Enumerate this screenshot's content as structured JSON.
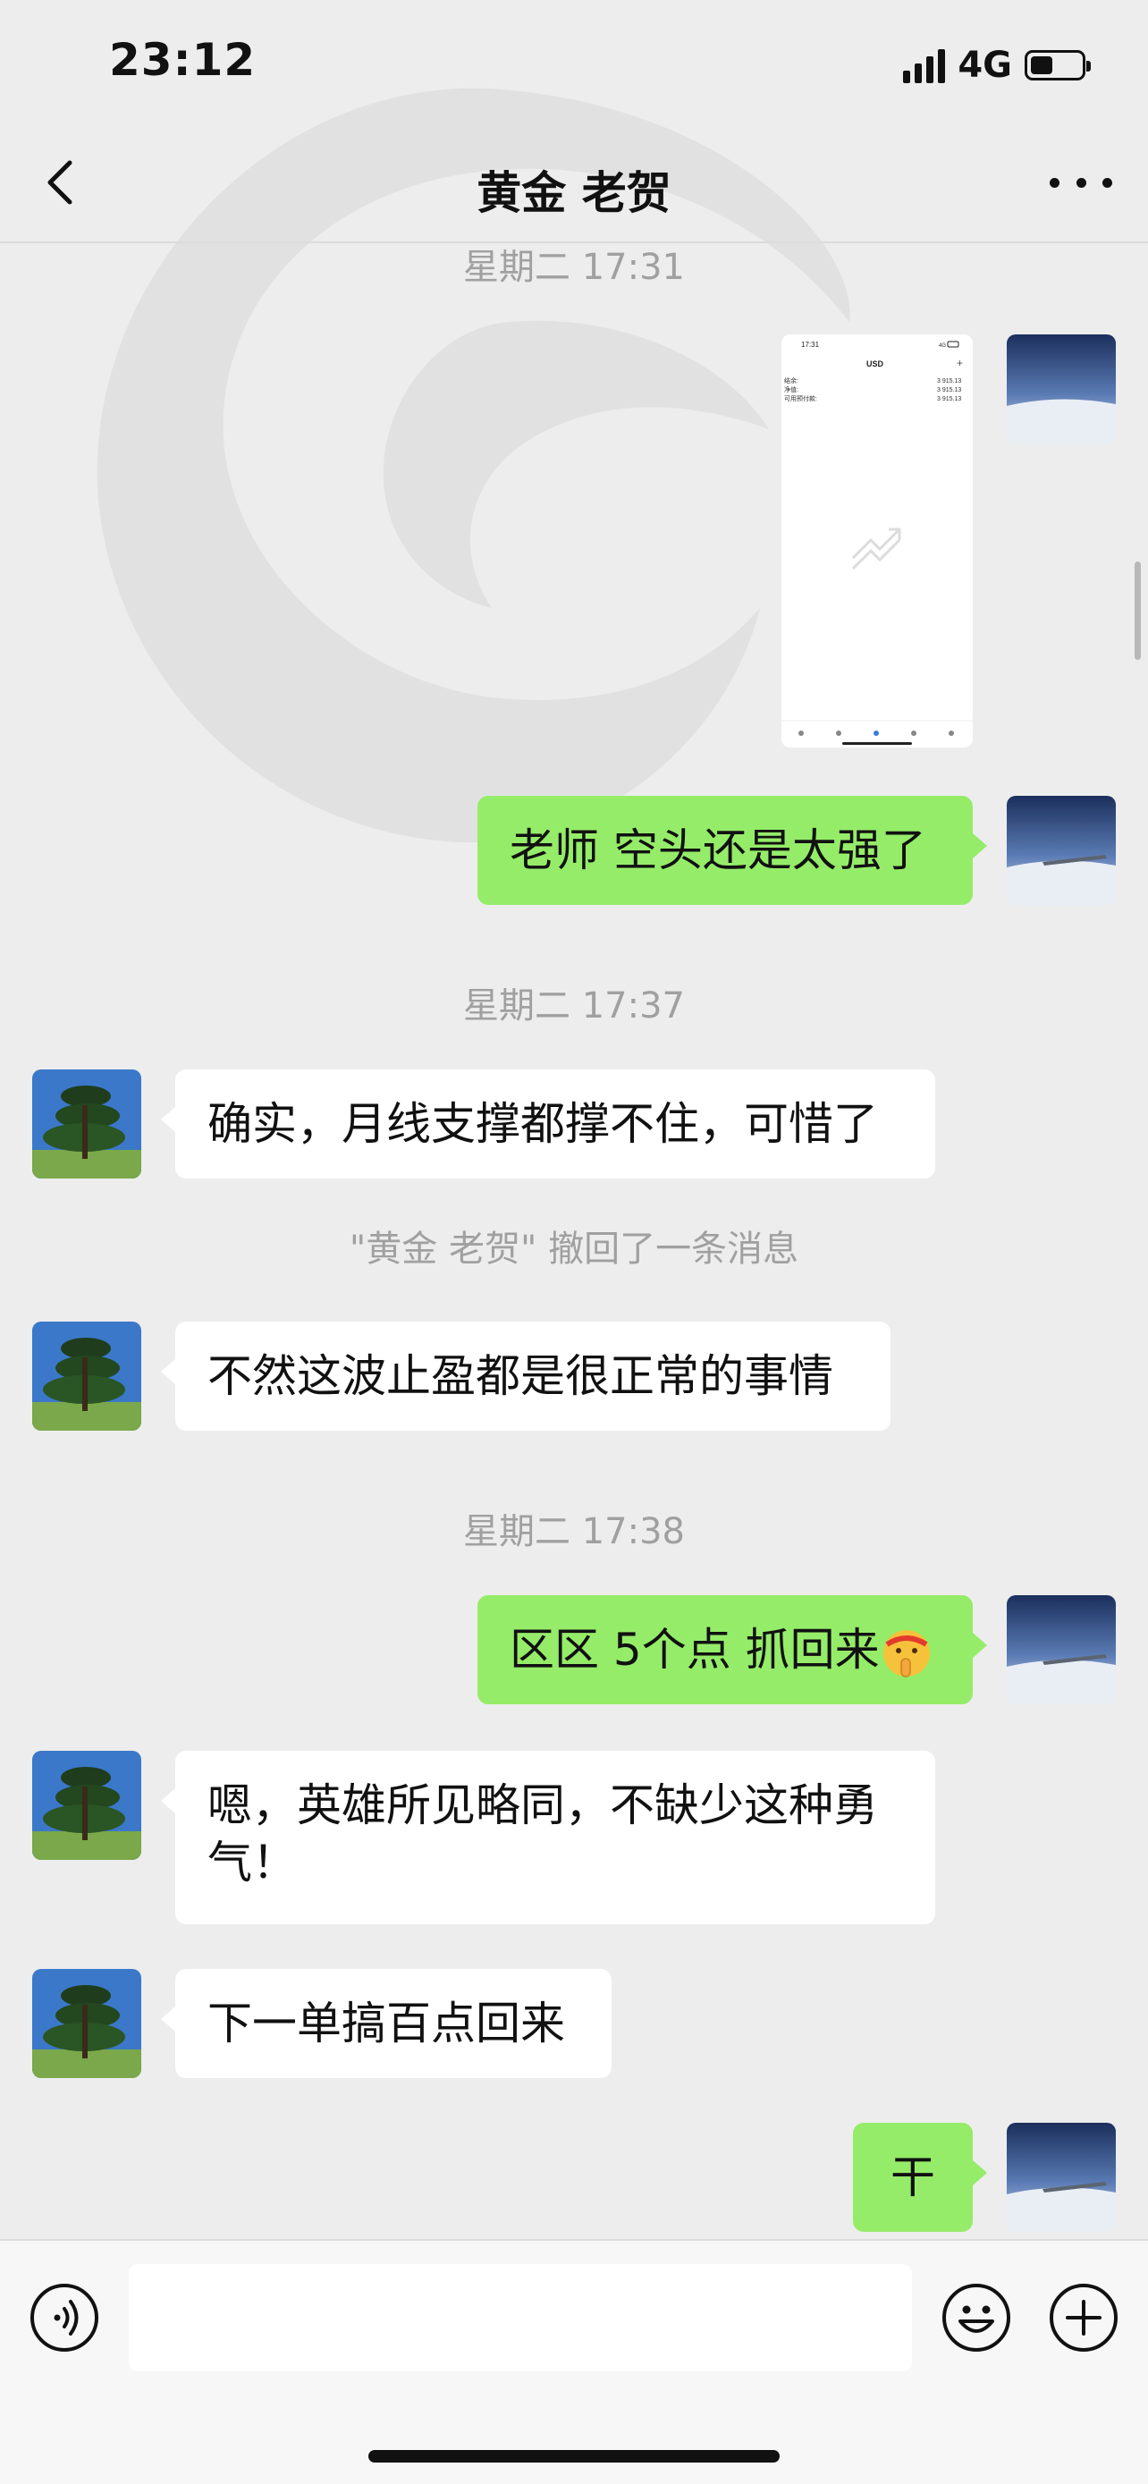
{
  "status_bar": {
    "time": "23:12",
    "network": "4G"
  },
  "header": {
    "title": "黄金 老贺"
  },
  "messages": {
    "t1": "星期二 17:31",
    "m1": "老师 空头还是太强了",
    "t2": "星期二 17:37",
    "m2": "确实，月线支撑都撑不住，可惜了",
    "recall": "\"黄金 老贺\" 撤回了一条消息",
    "m3": "不然这波止盈都是很正常的事情",
    "t3": "星期二 17:38",
    "m4": "区区 5个点 抓回来",
    "m5": "嗯，英雄所见略同，不缺少这种勇气！",
    "m6": "下一单搞百点回来",
    "m7": "干"
  },
  "shared_image": {
    "time": "17:31",
    "net": "4G",
    "title": "USD",
    "rows": [
      {
        "label": "结余:",
        "value": "3 915.13"
      },
      {
        "label": "净值:",
        "value": "3 915.13"
      },
      {
        "label": "可用预付款:",
        "value": "3 915.13"
      }
    ]
  },
  "icons": {
    "back": "chevron-left-icon",
    "more": "more-dots-icon",
    "voice": "voice-icon",
    "emoji": "smiley-icon",
    "plus": "plus-icon",
    "message_emoji": "shushing-face-emoji"
  },
  "colors": {
    "bubble_self": "#95ec69",
    "bubble_other": "#ffffff",
    "background": "#ededed"
  }
}
